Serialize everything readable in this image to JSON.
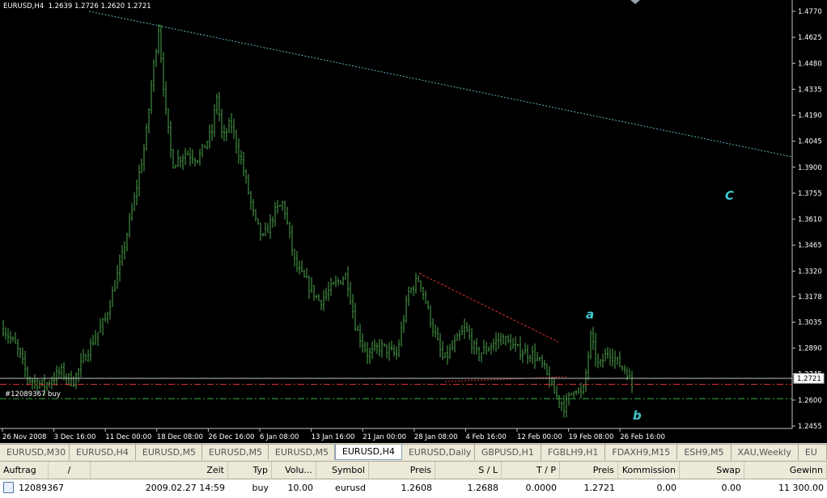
{
  "chart": {
    "header": "EURUSD,H4  1.2639 1.2726 1.2620 1.2721",
    "background": "#000000",
    "candle_color": "#4ca64c",
    "price_labels": [
      "1.4770",
      "1.4625",
      "1.4480",
      "1.4335",
      "1.4190",
      "1.4045",
      "1.3900",
      "1.3755",
      "1.3610",
      "1.3465",
      "1.3320",
      "1.3178",
      "1.3035",
      "1.2890",
      "1.2745",
      "1.2600",
      "1.2455"
    ],
    "current_price": "1.2721",
    "time_labels": [
      "26 Nov 2008",
      "3 Dec 16:00",
      "11 Dec 00:00",
      "18 Dec 08:00",
      "26 Dec 16:00",
      "6 Jan 08:00",
      "13 Jan 16:00",
      "21 Jan 00:00",
      "28 Jan 08:00",
      "4 Feb 16:00",
      "12 Feb 00:00",
      "19 Feb 08:00",
      "26 Feb 16:00"
    ],
    "order_label": "#12089367 buy",
    "wave_labels": {
      "a": "a",
      "b": "b",
      "c": "C"
    },
    "wave_color": "#3fc9d0",
    "lines": {
      "trend_color": "#5fb9c0",
      "resistance_color": "#e03030",
      "sl_color": "#e03030",
      "entry_color": "#3cb043",
      "bid_color": "#c0c0c0"
    }
  },
  "tabs": [
    "EURUSD,M30",
    "EURUSD,H4",
    "EURUSD,M5",
    "EURUSD,M5",
    "EURUSD,M5",
    "EURUSD,H4",
    "EURUSD,Daily",
    "GBPUSD,H1",
    "FGBLH9,H1",
    "FDAXH9,M15",
    "ESH9,M5",
    "XAU,Weekly",
    "EU"
  ],
  "active_tab_index": 5,
  "terminal": {
    "columns": [
      "Auftrag",
      "/",
      "Zeit",
      "Typ",
      "Volu...",
      "Symbol",
      "Preis",
      "S / L",
      "T / P",
      "Preis",
      "Kommission",
      "Swap",
      "Gewinn"
    ],
    "rows": [
      [
        "12089367",
        "2009.02.27 14:59",
        "buy",
        "10.00",
        "eurusd",
        "1.2608",
        "1.2688",
        "0.0000",
        "1.2721",
        "0.00",
        "0.00",
        "11 300.00"
      ]
    ]
  }
}
